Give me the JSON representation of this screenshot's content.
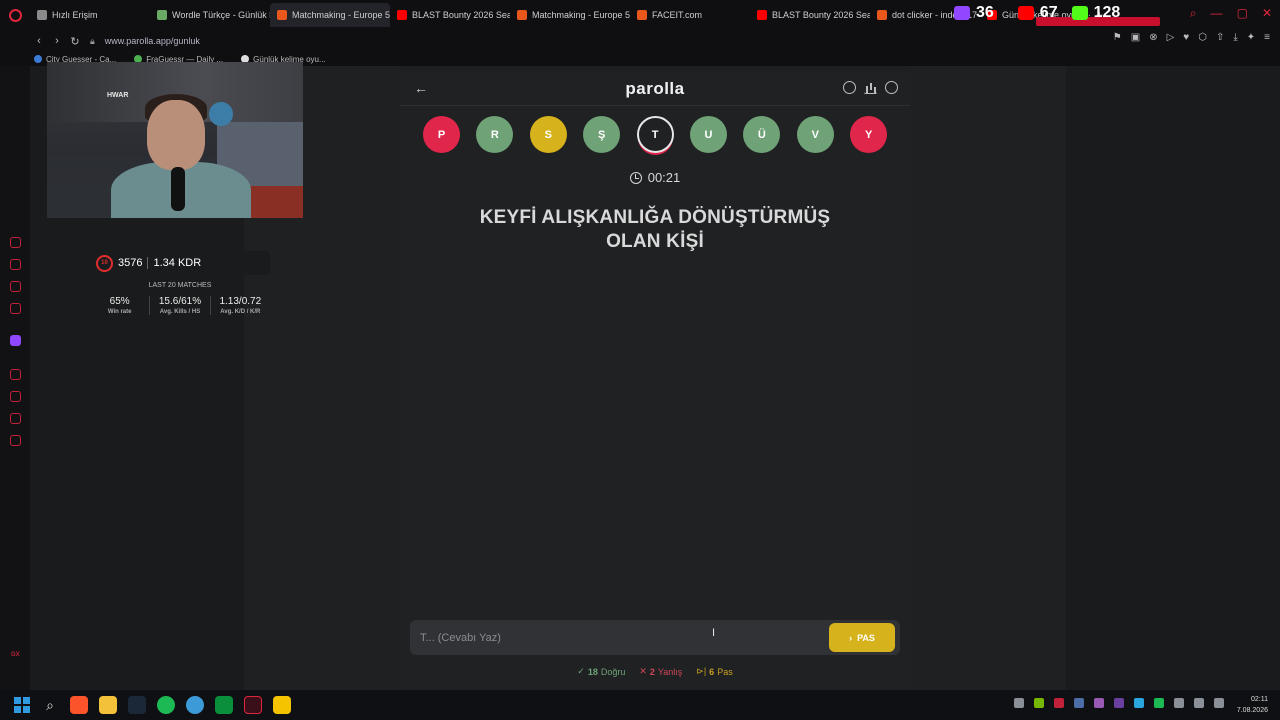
{
  "browser": {
    "tabs": [
      {
        "label": "Hızlı Erişim",
        "color": "#8a8a8a",
        "width": 120
      },
      {
        "label": "Wordle Türkçe - Günlük k",
        "color": "#6aaa64",
        "width": 120
      },
      {
        "label": "Matchmaking - Europe 5v",
        "color": "#e8581c",
        "width": 120,
        "active": true
      },
      {
        "label": "BLAST Bounty 2026 Seas",
        "color": "#ff0000",
        "width": 120
      },
      {
        "label": "Matchmaking - Europe 5v",
        "color": "#e8581c",
        "width": 120
      },
      {
        "label": "FACEIT.com",
        "color": "#e8581c",
        "width": 120
      },
      {
        "label": "BLAST Bounty 2026 Seas",
        "color": "#ff0000",
        "width": 120
      },
      {
        "label": "dot clicker - index: 17",
        "color": "#e8581c",
        "width": 110
      },
      {
        "label": "Günlük kelime oyunu -",
        "color": "#ff0000",
        "width": 110
      }
    ],
    "url": "www.parolla.app/gunluk",
    "bookmarks": [
      "City Guesser - Ca...",
      "FraGuessr — Daily ...",
      "Günlük kelime oyu..."
    ]
  },
  "overlay": {
    "twitch_count": "36",
    "youtube_count": "67",
    "kick_count": "128"
  },
  "faceit": {
    "elo": "3576",
    "kdr": "1.34 KDR",
    "title": "LAST 20 MATCHES",
    "stats": [
      {
        "value": "65%",
        "label": "Win rate"
      },
      {
        "value": "15.6/61%",
        "label": "Avg. Kills / HS"
      },
      {
        "value": "1.13/0.72",
        "label": "Avg. K/D / K/R"
      }
    ],
    "level": "10"
  },
  "webcam": {
    "sign": "HWAR"
  },
  "app": {
    "logo": "parolla",
    "letters": [
      {
        "char": "P",
        "state": "wrong",
        "color": "#e0264a"
      },
      {
        "char": "R",
        "state": "correct",
        "color": "#6fa276"
      },
      {
        "char": "S",
        "state": "passed",
        "color": "#d6b21c"
      },
      {
        "char": "Ş",
        "state": "correct",
        "color": "#6fa276"
      },
      {
        "char": "T",
        "state": "current",
        "color": "#1f2123"
      },
      {
        "char": "U",
        "state": "correct",
        "color": "#6fa276"
      },
      {
        "char": "Ü",
        "state": "correct",
        "color": "#6fa276"
      },
      {
        "char": "V",
        "state": "correct",
        "color": "#6fa276"
      },
      {
        "char": "Y",
        "state": "wrong",
        "color": "#e0264a"
      }
    ],
    "timer": "00:21",
    "question_line1": "KEYFİ ALIŞKANLIĞA DÖNÜŞTÜRMÜŞ",
    "question_line2": "OLAN KİŞİ",
    "answer_placeholder": "T... (Cevabı Yaz)",
    "pass_label": "PAS",
    "stats": {
      "correct_count": "18",
      "correct_label": "Doğru",
      "wrong_count": "2",
      "wrong_label": "Yanlış",
      "pass_count": "6",
      "pass_label": "Pas"
    }
  },
  "taskbar": {
    "time": "02:11",
    "date": "7.08.2026"
  }
}
